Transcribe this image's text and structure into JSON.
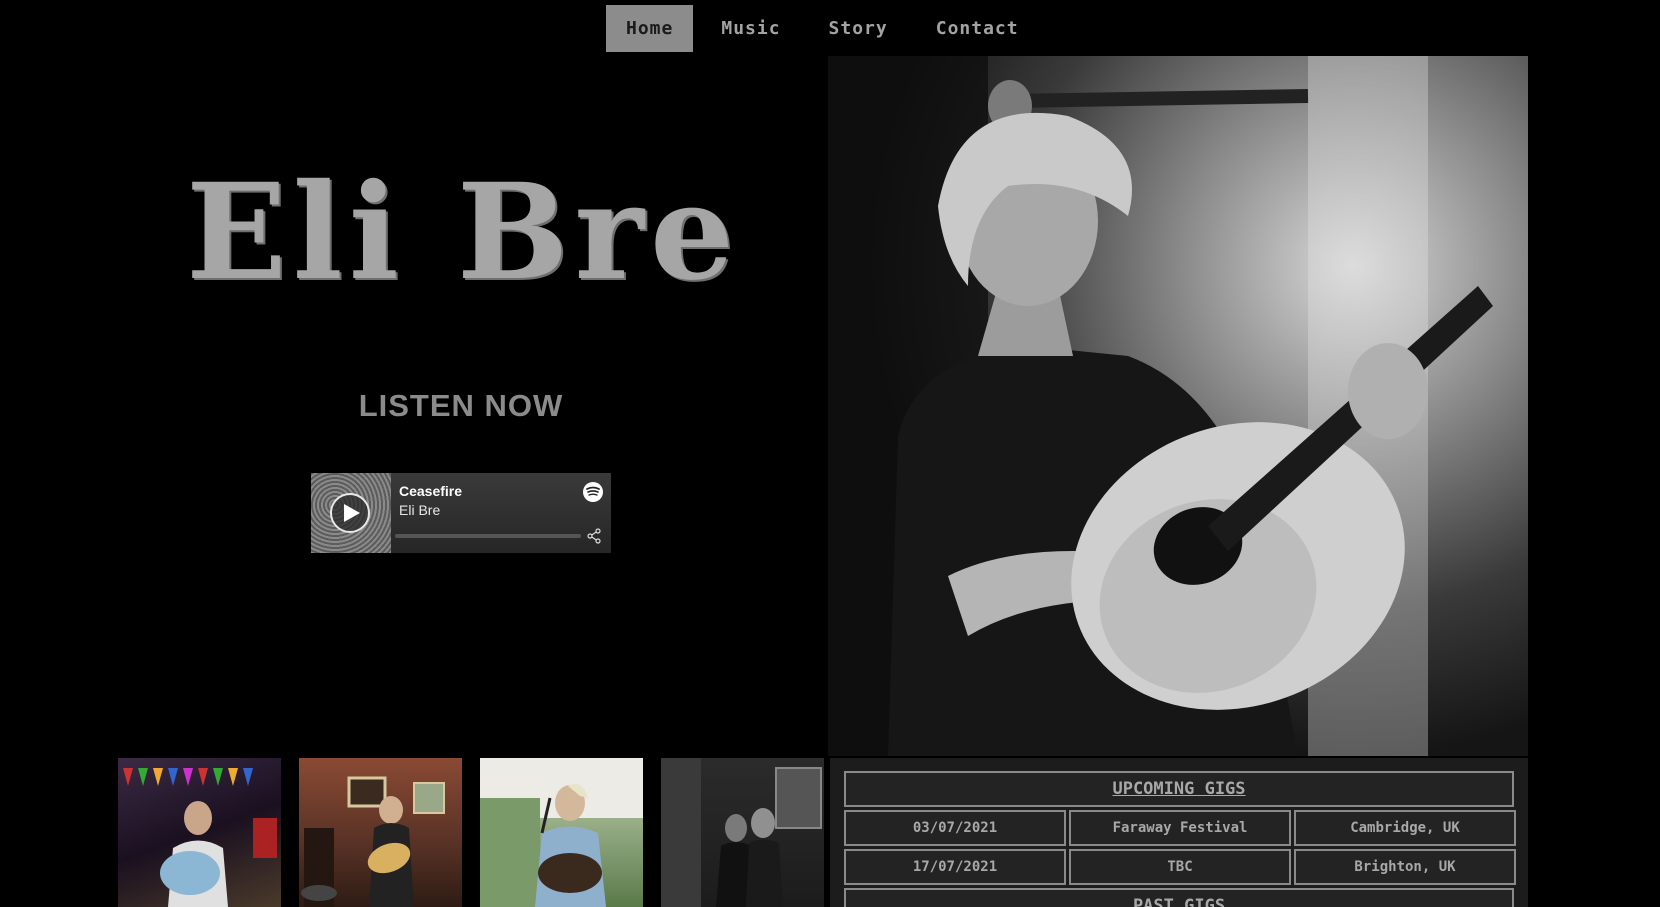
{
  "nav": {
    "items": [
      {
        "label": "Home",
        "active": true
      },
      {
        "label": "Music",
        "active": false
      },
      {
        "label": "Story",
        "active": false
      },
      {
        "label": "Contact",
        "active": false
      }
    ]
  },
  "hero": {
    "title": "Eli Bre",
    "cta": "LISTEN NOW"
  },
  "player": {
    "track": "Ceasefire",
    "artist": "Eli Bre",
    "progress": 0.0,
    "icons": [
      "play-icon",
      "spotify-icon",
      "share-icon"
    ]
  },
  "thumbnails": [
    {
      "name": "gig-photo-1"
    },
    {
      "name": "gig-photo-2"
    },
    {
      "name": "gig-photo-3"
    },
    {
      "name": "gig-photo-4"
    }
  ],
  "gigs": {
    "upcoming_heading": "UPCOMING GIGS",
    "upcoming": [
      {
        "date": "03/07/2021",
        "venue": "Faraway Festival",
        "location": "Cambridge, UK"
      },
      {
        "date": "17/07/2021",
        "venue": "TBC",
        "location": "Brighton, UK"
      }
    ],
    "past_heading": "PAST GIGS"
  },
  "colors": {
    "background": "#000000",
    "nav_active_bg": "#8c8c8c",
    "text": "#a6a6a6",
    "panel": "#1c1c1c",
    "border": "#8a8a8a"
  }
}
